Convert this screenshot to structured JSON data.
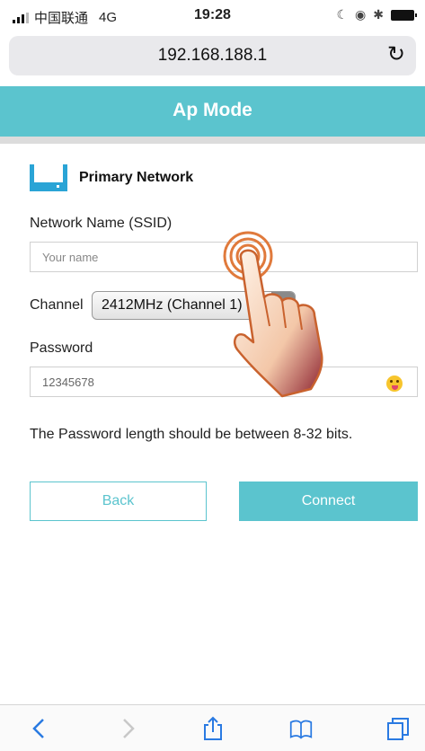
{
  "status_bar": {
    "carrier": "中国联通",
    "network": "4G",
    "time": "19:28",
    "icons": [
      "signal-icon",
      "orientation-lock-icon",
      "bluetooth-icon",
      "battery-icon"
    ]
  },
  "browser": {
    "url": "192.168.188.1",
    "reload_icon": "reload-icon"
  },
  "header": {
    "title": "Ap Mode",
    "color": "#5bc4ce"
  },
  "section": {
    "icon": "router-icon",
    "title": "Primary Network"
  },
  "form": {
    "ssid_label": "Network Name (SSID)",
    "ssid_placeholder": "Your name",
    "channel_label": "Channel",
    "channel_selected": "2412MHz (Channel 1)",
    "password_label": "Password",
    "password_value": "12345678",
    "password_toggle_icon": "emoji-tongue-icon",
    "note": "The Password length should be between 8-32 bits."
  },
  "buttons": {
    "back": "Back",
    "connect": "Connect"
  },
  "toolbar": {
    "items": [
      "back-icon",
      "forward-icon",
      "share-icon",
      "bookmarks-icon",
      "tabs-icon"
    ]
  }
}
